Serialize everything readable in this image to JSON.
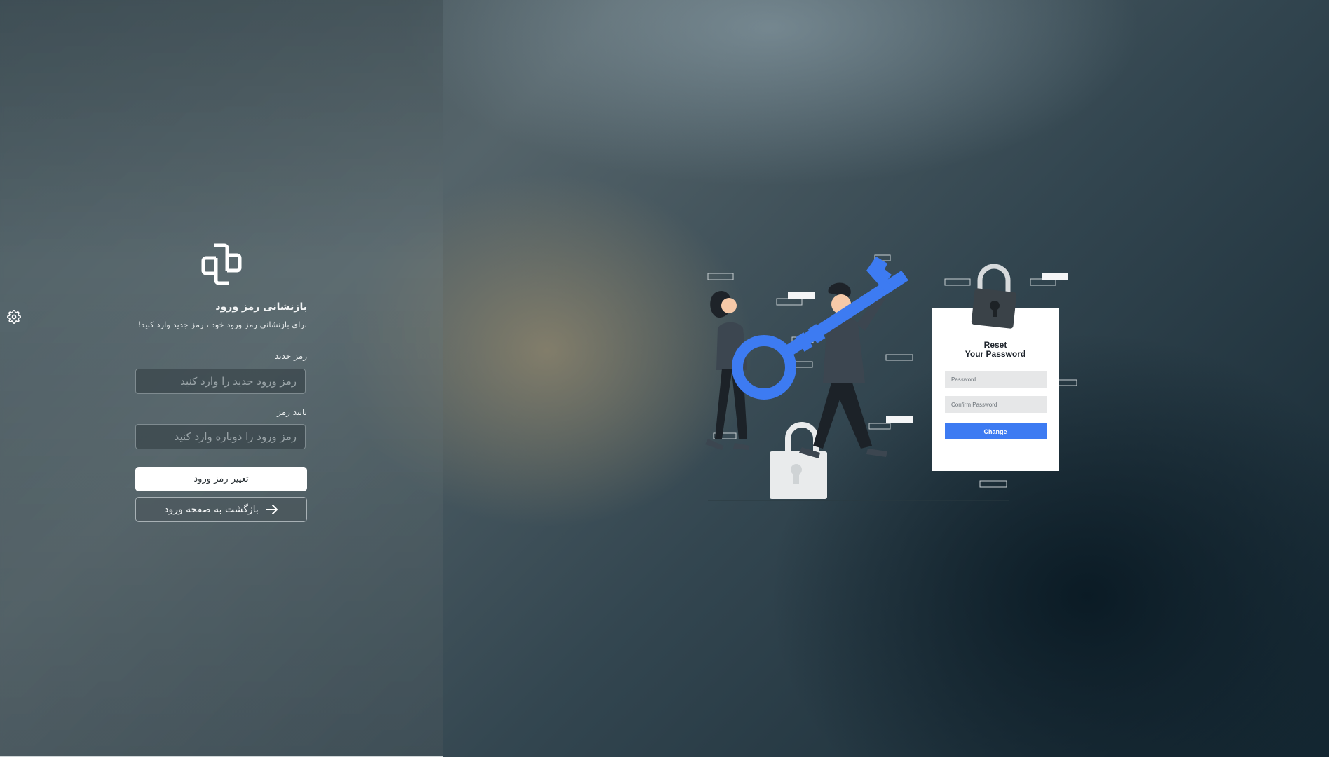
{
  "form": {
    "title": "بازنشانی رمز ورود",
    "subtitle": "برای بازنشانی رمز ورود خود ، رمز جدید وارد کنید!",
    "new_password_label": "رمز جدید",
    "new_password_placeholder": "رمز ورود جدید را وارد کنید",
    "new_password_value": "",
    "confirm_password_label": "تایید رمز",
    "confirm_password_placeholder": "رمز ورود را دوباره وارد کنید",
    "confirm_password_value": "",
    "submit_label": "تغییر رمز ورود",
    "back_label": "بازگشت به صفحه ورود"
  },
  "illustration": {
    "card_title_line1": "Reset",
    "card_title_line2": "Your Password",
    "card_password_placeholder": "Password",
    "card_confirm_placeholder": "Confirm Password",
    "card_button_label": "Change"
  },
  "colors": {
    "accent_blue": "#3d7bf2",
    "panel_tint": "#55656b"
  },
  "icons": {
    "settings": "gear-icon",
    "logo": "logo-icon",
    "back_arrow": "arrow-right-icon"
  }
}
